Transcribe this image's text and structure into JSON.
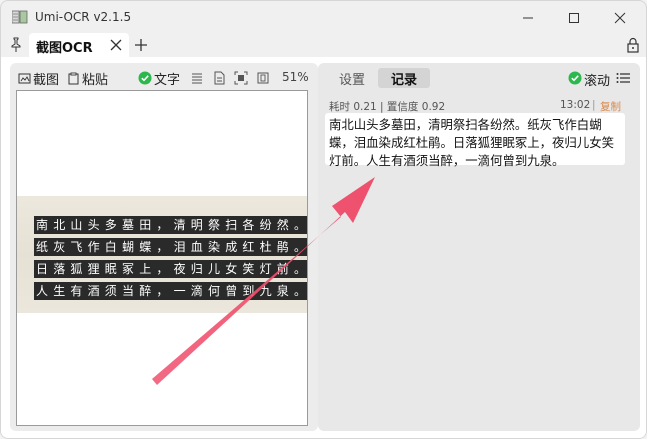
{
  "window": {
    "title": "Umi-OCR v2.1.5"
  },
  "tabs": [
    {
      "label": "截图OCR"
    }
  ],
  "left_toolbar": {
    "screenshot_label": "截图",
    "paste_label": "粘贴",
    "text_label": "文字",
    "zoom": "51%"
  },
  "image": {
    "lines": [
      "南北山头多墓田，清明祭扫各纷然。",
      "纸灰飞作白蝴蝶，泪血染成红杜鹃。",
      "日落狐狸眠冢上，夜归儿女笑灯前。",
      "人生有酒须当醉，一滴何曾到九泉。"
    ]
  },
  "right_panel": {
    "tabs": [
      "设置",
      "记录"
    ],
    "active_tab": "记录",
    "scroll_label": "滚动",
    "record": {
      "meta": "耗时 0.21 | 置信度 0.92",
      "time": "13:02",
      "separator": "|",
      "copy_label": "复制",
      "text": "南北山头多墓田，清明祭扫各纷然。纸灰飞作白蝴蝶，泪血染成红杜鹃。日落狐狸眠冢上，夜归儿女笑灯前。人生有酒须当醉，一滴何曾到九泉。"
    }
  },
  "colors": {
    "check_green": "#2db84d",
    "copy_orange": "#d9884a",
    "arrow_red": "#f0506e"
  },
  "icons": [
    "app-icon",
    "pin-icon",
    "close-icon",
    "plus-icon",
    "lock-icon",
    "minimize-icon",
    "maximize-icon",
    "screenshot-icon",
    "paste-icon",
    "check-icon",
    "list-icon",
    "file-icon",
    "scan-icon",
    "window-icon",
    "menu-icon"
  ]
}
